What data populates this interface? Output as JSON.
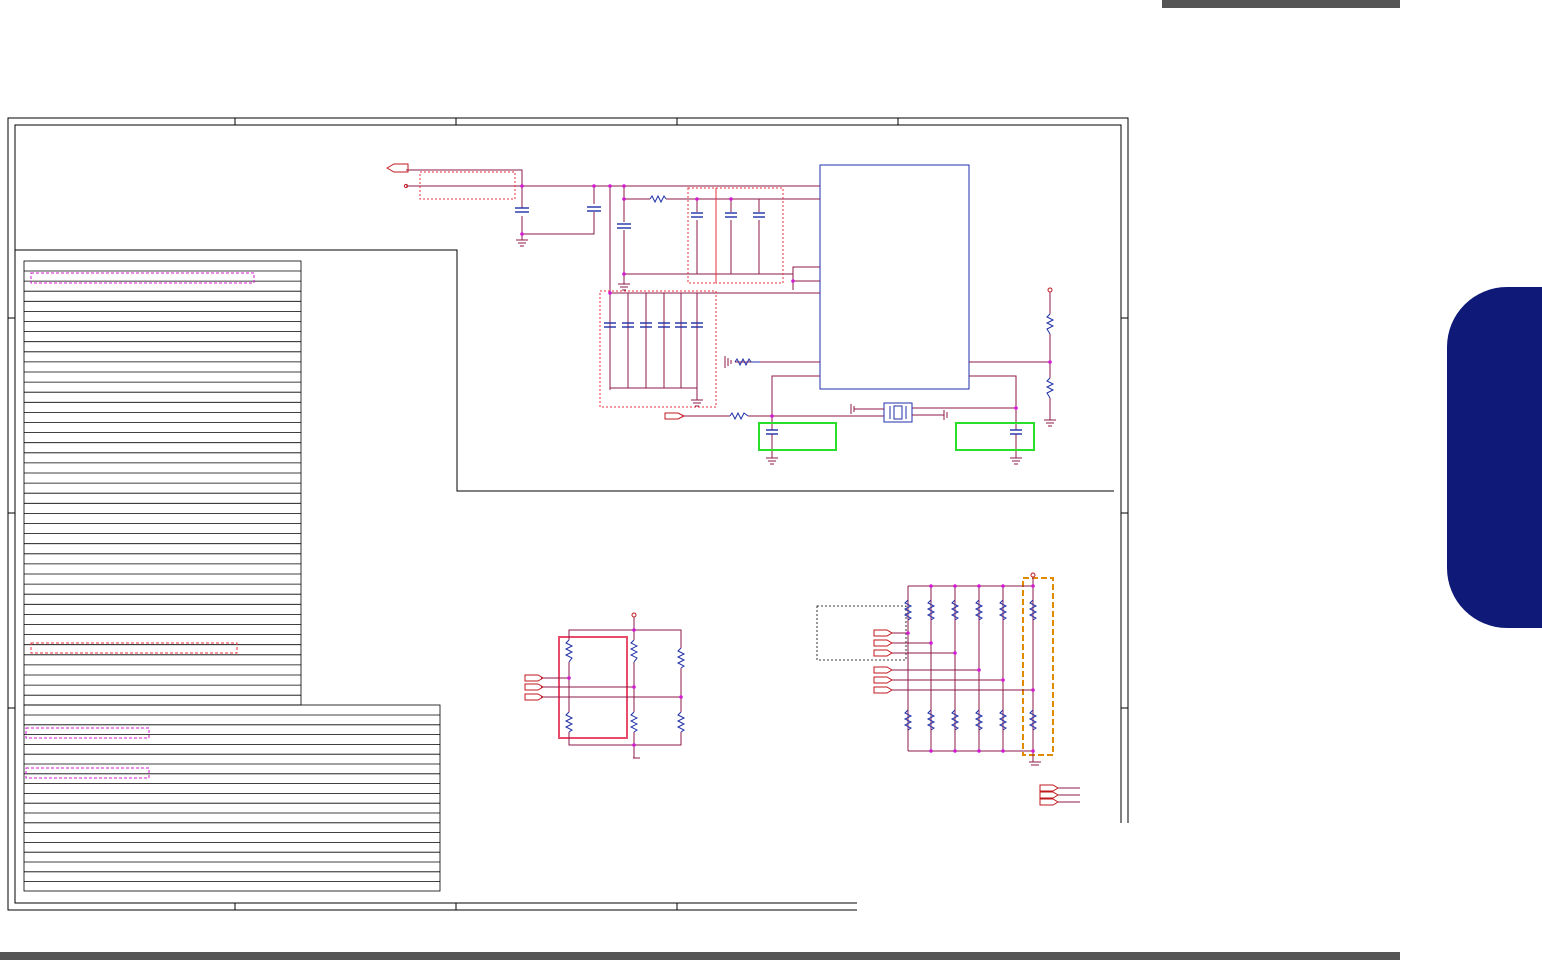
{
  "page": {
    "colors": {
      "frame": "#000000",
      "wire": "#8b1a4a",
      "component": "#1f2fa8",
      "port": "#c2191f",
      "dotted_group": "#e8323c",
      "highlight_green": "#2adf2a",
      "highlight_magenta": "#d21ad2",
      "highlight_orange": "#e08a00",
      "side_tab": "#0f1a78",
      "bars": "#555555"
    },
    "icons": [
      "port-arrow-icon",
      "ground-icon",
      "resistor-icon",
      "capacitor-icon",
      "crystal-icon"
    ]
  }
}
